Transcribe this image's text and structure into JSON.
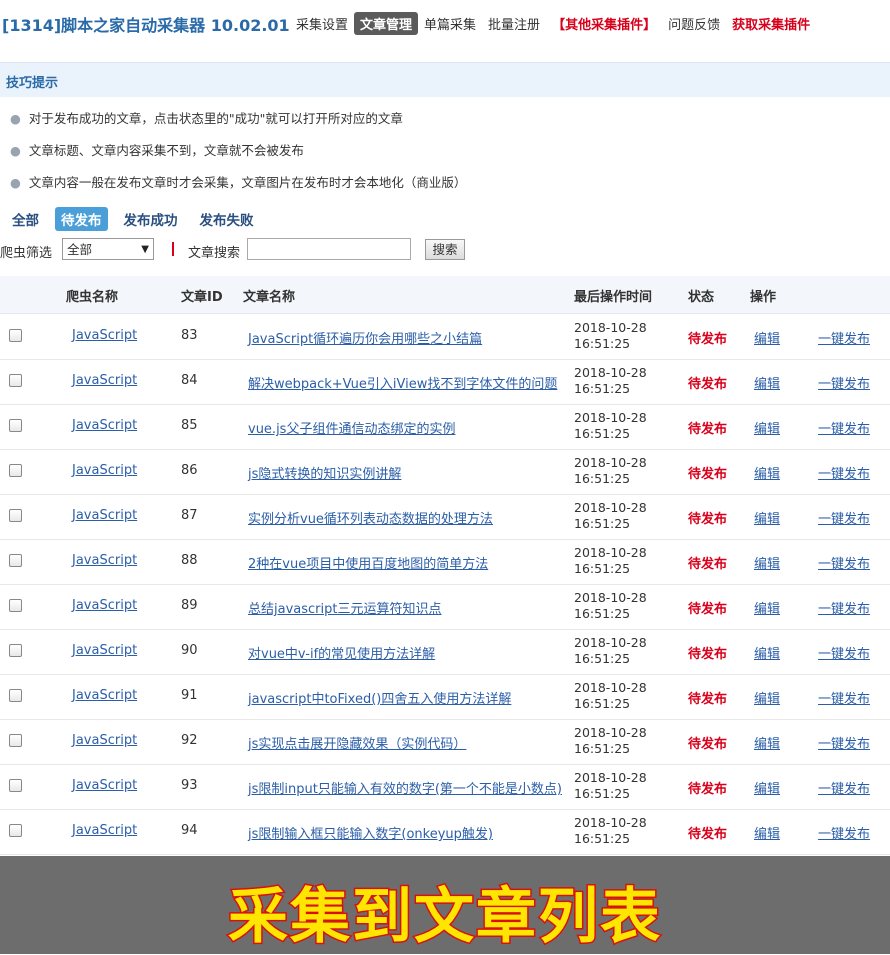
{
  "header": {
    "title": "[1314]脚本之家自动采集器 10.02.01",
    "nav": [
      {
        "label": "采集设置",
        "style": "normal"
      },
      {
        "label": "文章管理",
        "style": "active"
      },
      {
        "label": "单篇采集",
        "style": "normal"
      },
      {
        "label": "批量注册",
        "style": "normal"
      },
      {
        "label": "【其他采集插件】",
        "style": "red"
      },
      {
        "label": "问题反馈",
        "style": "normal"
      },
      {
        "label": "获取采集插件",
        "style": "red"
      }
    ]
  },
  "tips": {
    "title": "技巧提示",
    "items": [
      "对于发布成功的文章，点击状态里的\"成功\"就可以打开所对应的文章",
      "文章标题、文章内容采集不到，文章就不会被发布",
      "文章内容一般在发布文章时才会采集，文章图片在发布时才会本地化（商业版）"
    ]
  },
  "filter_tabs": [
    {
      "label": "全部",
      "active": false
    },
    {
      "label": "待发布",
      "active": true
    },
    {
      "label": "发布成功",
      "active": false
    },
    {
      "label": "发布失败",
      "active": false
    }
  ],
  "search": {
    "spider_filter_label": "爬虫筛选",
    "spider_filter_value": "全部",
    "article_search_label": "文章搜索",
    "button_label": "搜索"
  },
  "table": {
    "columns": [
      "爬虫名称",
      "文章ID",
      "文章名称",
      "最后操作时间",
      "状态",
      "操作"
    ],
    "rows": [
      {
        "spider": "JavaScript",
        "id": "83",
        "title": "JavaScript循环遍历你会用哪些之小结篇",
        "time": "2018-10-28 16:51:25",
        "status": "待发布",
        "edit": "编辑",
        "publish": "一键发布"
      },
      {
        "spider": "JavaScript",
        "id": "84",
        "title": "解决webpack+Vue引入iView找不到字体文件的问题",
        "time": "2018-10-28 16:51:25",
        "status": "待发布",
        "edit": "编辑",
        "publish": "一键发布"
      },
      {
        "spider": "JavaScript",
        "id": "85",
        "title": "vue.js父子组件通信动态绑定的实例",
        "time": "2018-10-28 16:51:25",
        "status": "待发布",
        "edit": "编辑",
        "publish": "一键发布"
      },
      {
        "spider": "JavaScript",
        "id": "86",
        "title": "js隐式转换的知识实例讲解",
        "time": "2018-10-28 16:51:25",
        "status": "待发布",
        "edit": "编辑",
        "publish": "一键发布"
      },
      {
        "spider": "JavaScript",
        "id": "87",
        "title": "实例分析vue循环列表动态数据的处理方法",
        "time": "2018-10-28 16:51:25",
        "status": "待发布",
        "edit": "编辑",
        "publish": "一键发布"
      },
      {
        "spider": "JavaScript",
        "id": "88",
        "title": "2种在vue项目中使用百度地图的简单方法",
        "time": "2018-10-28 16:51:25",
        "status": "待发布",
        "edit": "编辑",
        "publish": "一键发布"
      },
      {
        "spider": "JavaScript",
        "id": "89",
        "title": "总结javascript三元运算符知识点",
        "time": "2018-10-28 16:51:25",
        "status": "待发布",
        "edit": "编辑",
        "publish": "一键发布"
      },
      {
        "spider": "JavaScript",
        "id": "90",
        "title": "对vue中v-if的常见使用方法详解",
        "time": "2018-10-28 16:51:25",
        "status": "待发布",
        "edit": "编辑",
        "publish": "一键发布"
      },
      {
        "spider": "JavaScript",
        "id": "91",
        "title": "javascript中toFixed()四舍五入使用方法详解",
        "time": "2018-10-28 16:51:25",
        "status": "待发布",
        "edit": "编辑",
        "publish": "一键发布"
      },
      {
        "spider": "JavaScript",
        "id": "92",
        "title": "js实现点击展开隐藏效果（实例代码）",
        "time": "2018-10-28 16:51:25",
        "status": "待发布",
        "edit": "编辑",
        "publish": "一键发布"
      },
      {
        "spider": "JavaScript",
        "id": "93",
        "title": "js限制input只能输入有效的数字(第一个不能是小数点)",
        "time": "2018-10-28 16:51:25",
        "status": "待发布",
        "edit": "编辑",
        "publish": "一键发布"
      },
      {
        "spider": "JavaScript",
        "id": "94",
        "title": "js限制输入框只能输入数字(onkeyup触发)",
        "time": "2018-10-28 16:51:25",
        "status": "待发布",
        "edit": "编辑",
        "publish": "一键发布"
      }
    ]
  },
  "caption": "采集到文章列表",
  "colors": {
    "brand_blue": "#2a6aa8",
    "status_red": "#d9001b",
    "active_tab": "#4a9fd8",
    "caption_yellow": "#ffe600"
  }
}
